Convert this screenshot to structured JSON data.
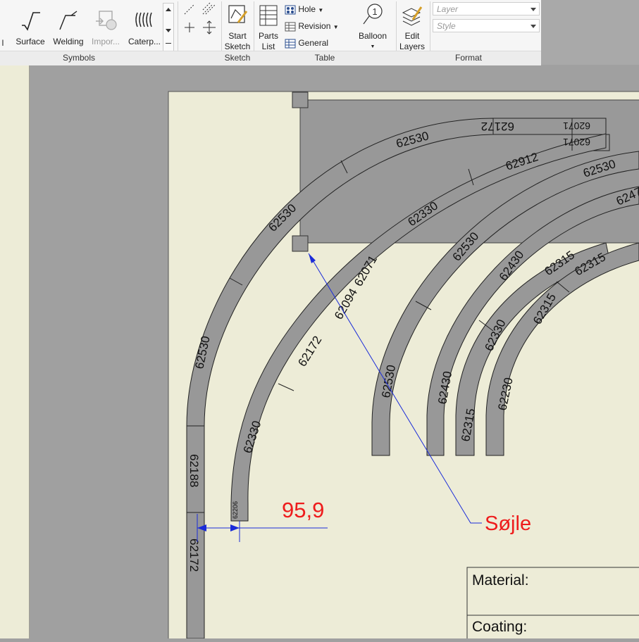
{
  "ribbon": {
    "groups": {
      "symbols": "Symbols",
      "sketch": "Sketch",
      "table": "Table",
      "format": "Format"
    },
    "tools": {
      "surface": "Surface",
      "welding": "Welding",
      "import": "Impor...",
      "caterpillar": "Caterp...",
      "start_sketch_1": "Start",
      "start_sketch_2": "Sketch",
      "parts_list_1": "Parts",
      "parts_list_2": "List",
      "hole": "Hole",
      "revision": "Revision",
      "general": "General",
      "balloon": "Balloon",
      "balloon_number": "1",
      "edit_layers_1": "Edit",
      "edit_layers_2": "Layers"
    },
    "format": {
      "layer_placeholder": "Layer",
      "style_placeholder": "Style"
    }
  },
  "drawing": {
    "dimension_value": "95,9",
    "leader_note": "Søjle",
    "title_block": {
      "material_label": "Material:",
      "coating_label": "Coating:"
    },
    "track_labels": [
      "62530",
      "62172",
      "62071",
      "62071",
      "62912",
      "62530",
      "62530",
      "62530",
      "62330",
      "62530",
      "62094",
      "62071",
      "62530",
      "62172",
      "62330",
      "62430",
      "62530",
      "62430",
      "62315",
      "62315",
      "62315",
      "62330",
      "62315",
      "62230",
      "62188",
      "62172",
      "62206",
      "6247"
    ]
  },
  "colors": {
    "sheet": "#edecd7",
    "track_fill": "#989898",
    "annotation_red": "#ee1c1c",
    "leader_blue": "#1a2bd8"
  }
}
